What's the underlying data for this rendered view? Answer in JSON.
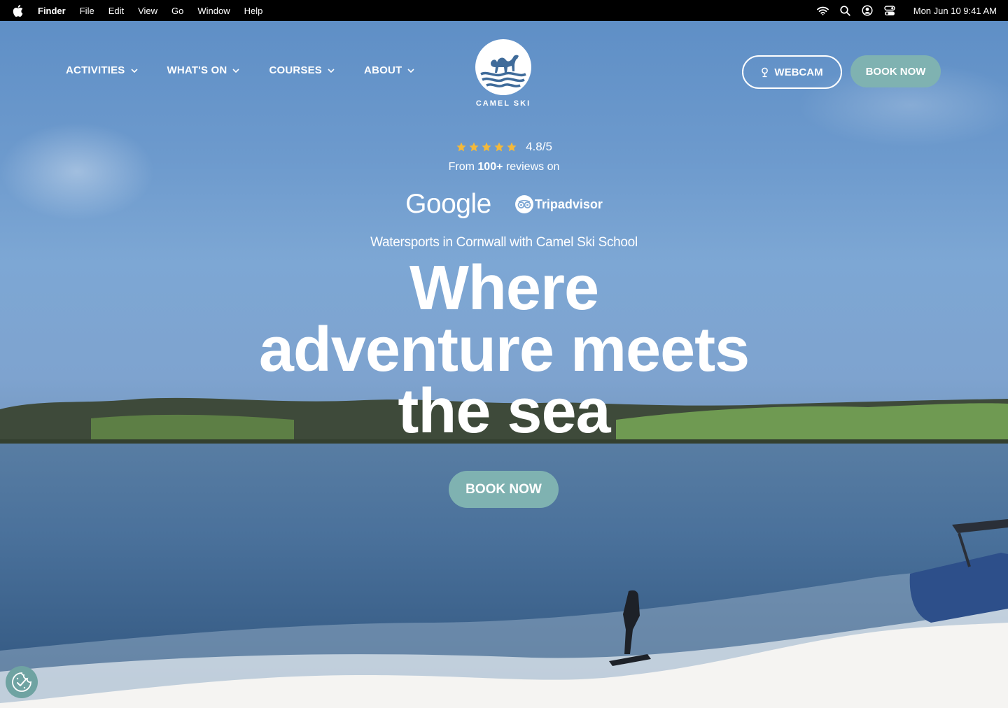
{
  "menubar": {
    "app_name": "Finder",
    "menus": [
      "File",
      "Edit",
      "View",
      "Go",
      "Window",
      "Help"
    ],
    "datetime": "Mon Jun 10  9:41 AM",
    "icons": [
      "apple-icon",
      "wifi-icon",
      "search-icon",
      "user-icon",
      "control-center-icon"
    ]
  },
  "nav": {
    "items": [
      {
        "label": "ACTIVITIES"
      },
      {
        "label": "WHAT'S ON"
      },
      {
        "label": "COURSES"
      },
      {
        "label": "ABOUT"
      }
    ]
  },
  "logo": {
    "text": "CAMEL SKI"
  },
  "header": {
    "webcam_label": "WEBCAM",
    "book_label": "BOOK NOW"
  },
  "hero": {
    "rating": "4.8/5",
    "stars": 5,
    "reviews_prefix": "From ",
    "reviews_count": "100+",
    "reviews_suffix": " reviews on",
    "brands": [
      "Google",
      "Tripadvisor"
    ],
    "subtitle": "Watersports in Cornwall with Camel Ski School",
    "headline": [
      "Where",
      "adventure meets",
      "the sea"
    ],
    "cta_label": "BOOK NOW"
  },
  "colors": {
    "accent": "#7fb2b1",
    "sky": "#6d9acd",
    "sea": "#3f6690",
    "star": "#f4b93a",
    "wave": "#f5f4f2"
  }
}
